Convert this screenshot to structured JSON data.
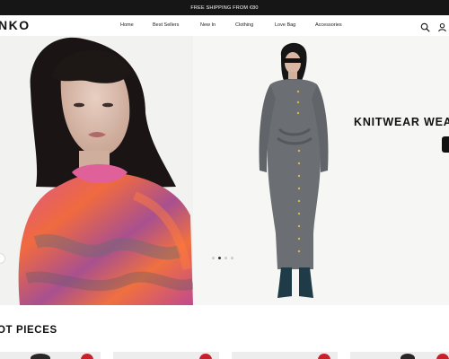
{
  "promo": {
    "text": "FREE SHIPPING FROM €80"
  },
  "header": {
    "logo": "NKO",
    "nav": [
      "Home",
      "Best Sellers",
      "New In",
      "Clothing",
      "Love Bag",
      "Accessories"
    ],
    "icons": [
      "search-icon",
      "account-icon"
    ]
  },
  "hero": {
    "title": "KNITWEAR WEA",
    "slides": 4,
    "active_slide": 2
  },
  "section": {
    "title": "OT PIECES"
  },
  "colors": {
    "promo_bg": "#161616",
    "accent": "#c8202a",
    "text": "#111111"
  }
}
